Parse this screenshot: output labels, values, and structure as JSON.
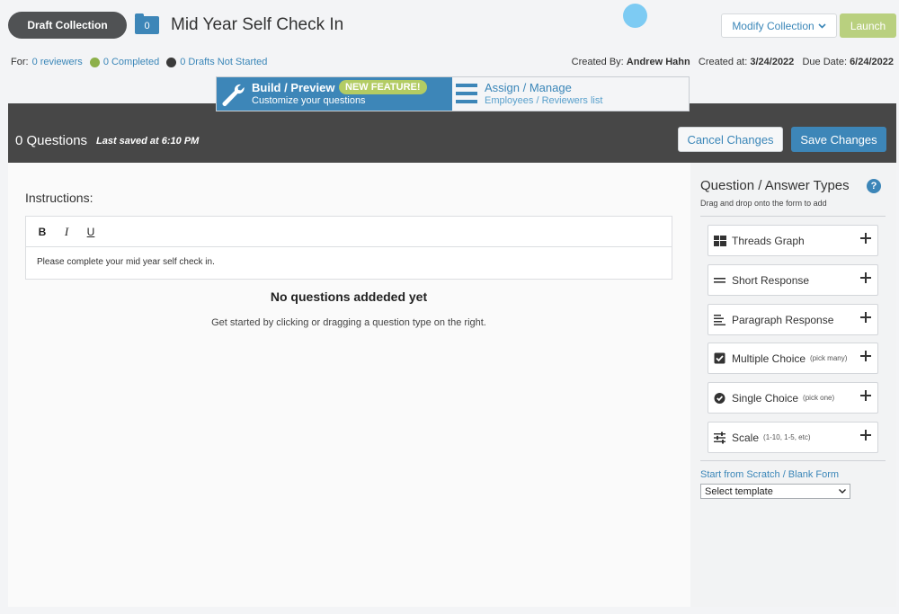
{
  "header": {
    "draft_label": "Draft Collection",
    "folder_count": "0",
    "title": "Mid Year Self Check In",
    "modify_label": "Modify Collection",
    "launch_label": "Launch"
  },
  "meta": {
    "for_label": "For:",
    "reviewers": "0 reviewers",
    "completed": "0 Completed",
    "drafts": "0 Drafts Not Started",
    "created_by_label": "Created By:",
    "created_by": "Andrew Hahn",
    "created_at_label": "Created at:",
    "created_at": "3/24/2022",
    "due_label": "Due Date:",
    "due": "6/24/2022"
  },
  "tabs": {
    "build_title": "Build / Preview",
    "build_badge": "NEW FEATURE!",
    "build_sub": "Customize your questions",
    "assign_title": "Assign / Manage",
    "assign_sub": "Employees / Reviewers list"
  },
  "toolbar": {
    "question_count": "0 Questions",
    "saved": "Last saved at 6:10 PM",
    "cancel_label": "Cancel Changes",
    "save_label": "Save Changes"
  },
  "editor": {
    "instructions_label": "Instructions:",
    "bold": "B",
    "italic": "I",
    "underline": "U",
    "body": "Please complete your mid year self check in.",
    "empty_title": "No questions addeded yet",
    "empty_sub": "Get started by clicking or dragging a question type on the right."
  },
  "sidebar": {
    "title": "Question / Answer Types",
    "help": "?",
    "subtitle": "Drag and drop onto the form to add",
    "types": [
      {
        "label": "Threads Graph",
        "hint": "",
        "icon": "grid-icon"
      },
      {
        "label": "Short Response",
        "hint": "",
        "icon": "short-lines-icon"
      },
      {
        "label": "Paragraph Response",
        "hint": "",
        "icon": "paragraph-icon"
      },
      {
        "label": "Multiple Choice",
        "hint": "(pick many)",
        "icon": "checkbox-icon"
      },
      {
        "label": "Single Choice",
        "hint": "(pick one)",
        "icon": "check-circle-icon"
      },
      {
        "label": "Scale",
        "hint": "(1-10, 1-5, etc)",
        "icon": "sliders-icon"
      }
    ],
    "scratch_label": "Start from Scratch / Blank Form",
    "template_value": "Select template"
  },
  "colors": {
    "primary": "#3d86b8",
    "accent_green": "#b3cc64",
    "completed_dot": "#8db04a",
    "drafts_dot": "#3a3a3a",
    "dark_bar": "#474747"
  }
}
